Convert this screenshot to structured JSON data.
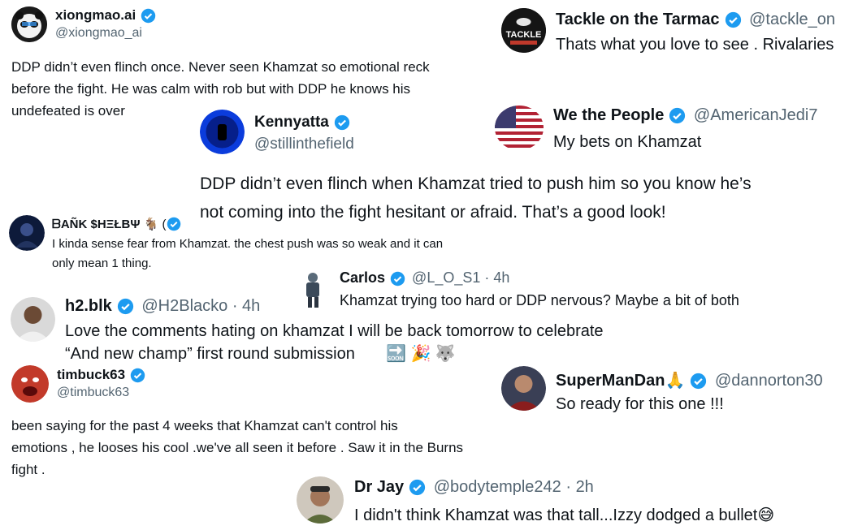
{
  "posts": [
    {
      "name": "xiongmao.ai",
      "handle": "@xiongmao_ai",
      "lines": [
        "DDP didn’t even flinch once.  Never seen Khamzat so emotional reck",
        "before the fight.  He was calm with rob but with DDP he knows his",
        "undefeated is over"
      ]
    },
    {
      "name": "Tackle on the Tarmac",
      "handle": "@tackle_on",
      "text": "Thats what you love to see . Rivalaries",
      "avatar_text": "TACKLE"
    },
    {
      "name": "Kennyatta",
      "handle": "@stillinthefield",
      "lines": [
        "DDP didn’t even flinch when Khamzat tried to push him so you know he’s",
        "not coming into the fight hesitant or afraid. That’s a good look!"
      ]
    },
    {
      "name": "We the People",
      "handle": "@AmericanJedi7",
      "text": "My bets on Khamzat"
    },
    {
      "name": "ᗷAÑK $HΞŁВΨ",
      "name_suffix": "🐐 (",
      "lines": [
        "I kinda sense fear from Khamzat. the chest push was so weak and it can",
        "only mean 1 thing."
      ]
    },
    {
      "name": "Carlos",
      "handle": "@L_O_S1 · 4h",
      "text": "Khamzat trying too hard or DDP nervous? Maybe a bit of both"
    },
    {
      "name": "h2.blk",
      "handle": "@H2Blacko · 4h",
      "lines": [
        "Love the comments hating on khamzat I will be back tomorrow to celebrate",
        "“And new champ” first round submission"
      ],
      "emoji": "🔜 🎉 🐺",
      "emoji_soon": "SOON"
    },
    {
      "name": "timbuck63",
      "handle": "@timbuck63",
      "lines": [
        "been saying for the past 4 weeks that Khamzat can't control his",
        "emotions , he looses his cool .we've all seen it before . Saw it in the Burns",
        "fight ."
      ]
    },
    {
      "name": "SuperManDan",
      "name_emoji": "🙏",
      "handle": "@dannorton30",
      "text": "So ready for this one !!!"
    },
    {
      "name": "Dr Jay",
      "handle": "@bodytemple242 · 2h",
      "text": "I didn't think Khamzat was that tall...Izzy dodged a bullet",
      "text_emoji": "😅"
    }
  ],
  "colors": {
    "verified": "#1d9bf0",
    "handle": "#536471",
    "text": "#0f1419"
  }
}
